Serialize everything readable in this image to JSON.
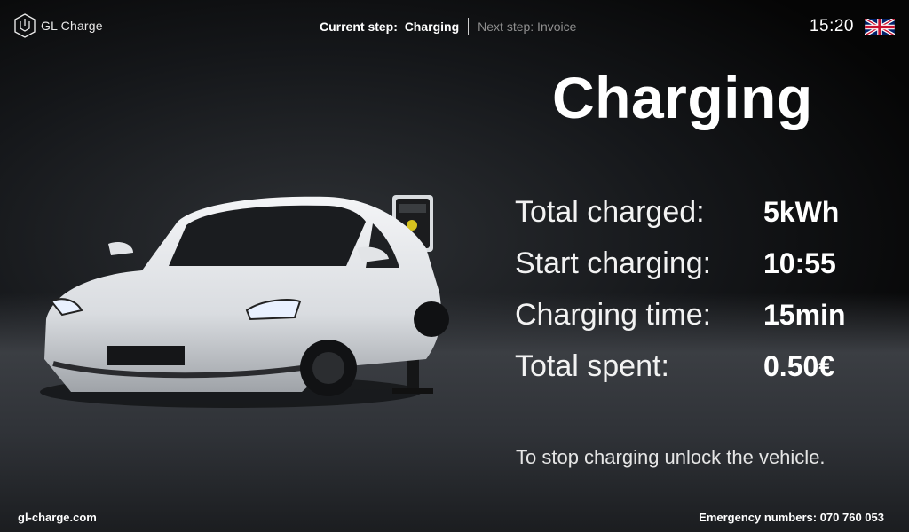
{
  "header": {
    "logo_text": "GL Charge",
    "current_step_label": "Current step:",
    "current_step_value": "Charging",
    "next_step": "Next step: Invoice",
    "clock": "15:20",
    "language_icon": "uk-flag-icon"
  },
  "main": {
    "title": "Charging",
    "stats": [
      {
        "label": "Total charged:",
        "value": "5kWh"
      },
      {
        "label": "Start charging:",
        "value": "10:55"
      },
      {
        "label": "Charging time:",
        "value": "15min"
      },
      {
        "label": "Total spent:",
        "value": "0.50€"
      }
    ],
    "hint": "To stop charging unlock the vehicle."
  },
  "footer": {
    "website": "gl-charge.com",
    "emergency": "Emergency numbers: 070 760 053"
  },
  "colors": {
    "background": "#0b0b0c",
    "text": "#ffffff",
    "muted": "#8f8f8f",
    "divider": "#8a8d91"
  }
}
